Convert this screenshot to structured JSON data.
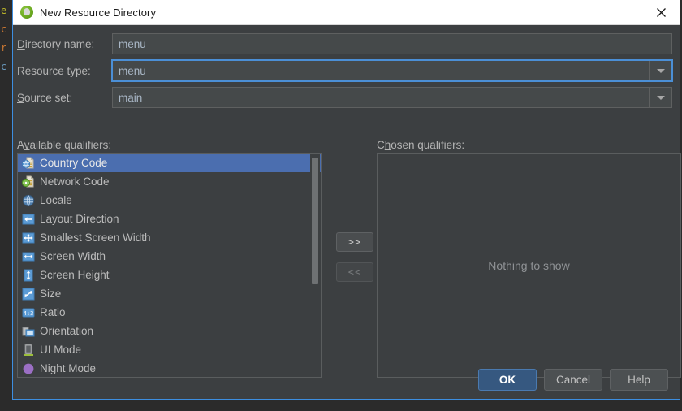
{
  "background_editor": {
    "name": "ide-editor-behind-dialog",
    "gutter_chars": [
      {
        "char": "e",
        "color": "#bbb529"
      },
      {
        "char": "c",
        "color": "#cc7832"
      },
      {
        "char": "r",
        "color": "#cc7832"
      },
      {
        "char": "c",
        "color": "#6897bb"
      }
    ],
    "background_color": "#2b2b2b"
  },
  "dialog": {
    "title": "New Resource Directory",
    "app_icon": "android-studio-icon",
    "close_icon": "close-icon",
    "border_color": "#3d8ee0",
    "titlebar_background": "#ffffff",
    "body_background": "#3c3f41"
  },
  "form": {
    "fields": [
      {
        "name": "directory-name",
        "label_prefix": "",
        "label_mnemonic": "D",
        "label_suffix": "irectory name:",
        "value": "menu",
        "type": "text",
        "focused": false,
        "has_dropdown": false
      },
      {
        "name": "resource-type",
        "label_prefix": "",
        "label_mnemonic": "R",
        "label_suffix": "esource type:",
        "value": "menu",
        "type": "combobox",
        "focused": true,
        "has_dropdown": true
      },
      {
        "name": "source-set",
        "label_prefix": "",
        "label_mnemonic": "S",
        "label_suffix": "ource set:",
        "value": "main",
        "type": "combobox",
        "focused": false,
        "has_dropdown": true
      }
    ]
  },
  "available": {
    "caption_prefix": "A",
    "caption_mnemonic": "v",
    "caption_suffix": "ailable qualifiers:",
    "selected_index": 0,
    "selection_color": "#4b6eaf",
    "items": [
      {
        "label": "Country Code",
        "icon": "country-code-icon"
      },
      {
        "label": "Network Code",
        "icon": "network-code-icon"
      },
      {
        "label": "Locale",
        "icon": "locale-globe-icon"
      },
      {
        "label": "Layout Direction",
        "icon": "layout-direction-icon"
      },
      {
        "label": "Smallest Screen Width",
        "icon": "smallest-screen-width-icon"
      },
      {
        "label": "Screen Width",
        "icon": "screen-width-icon"
      },
      {
        "label": "Screen Height",
        "icon": "screen-height-icon"
      },
      {
        "label": "Size",
        "icon": "size-icon"
      },
      {
        "label": "Ratio",
        "icon": "ratio-icon"
      },
      {
        "label": "Orientation",
        "icon": "orientation-icon"
      },
      {
        "label": "UI Mode",
        "icon": "ui-mode-icon"
      },
      {
        "label": "Night Mode",
        "icon": "night-mode-icon"
      }
    ]
  },
  "transfer": {
    "add_label": ">>",
    "remove_label": "<<",
    "add_enabled": true,
    "remove_enabled": false
  },
  "chosen": {
    "caption_prefix": "C",
    "caption_mnemonic": "h",
    "caption_suffix": "osen qualifiers:",
    "empty_text": "Nothing to show"
  },
  "footer": {
    "ok_label": "OK",
    "cancel_label": "Cancel",
    "help_label": "Help",
    "default_button_color": "#365880"
  }
}
